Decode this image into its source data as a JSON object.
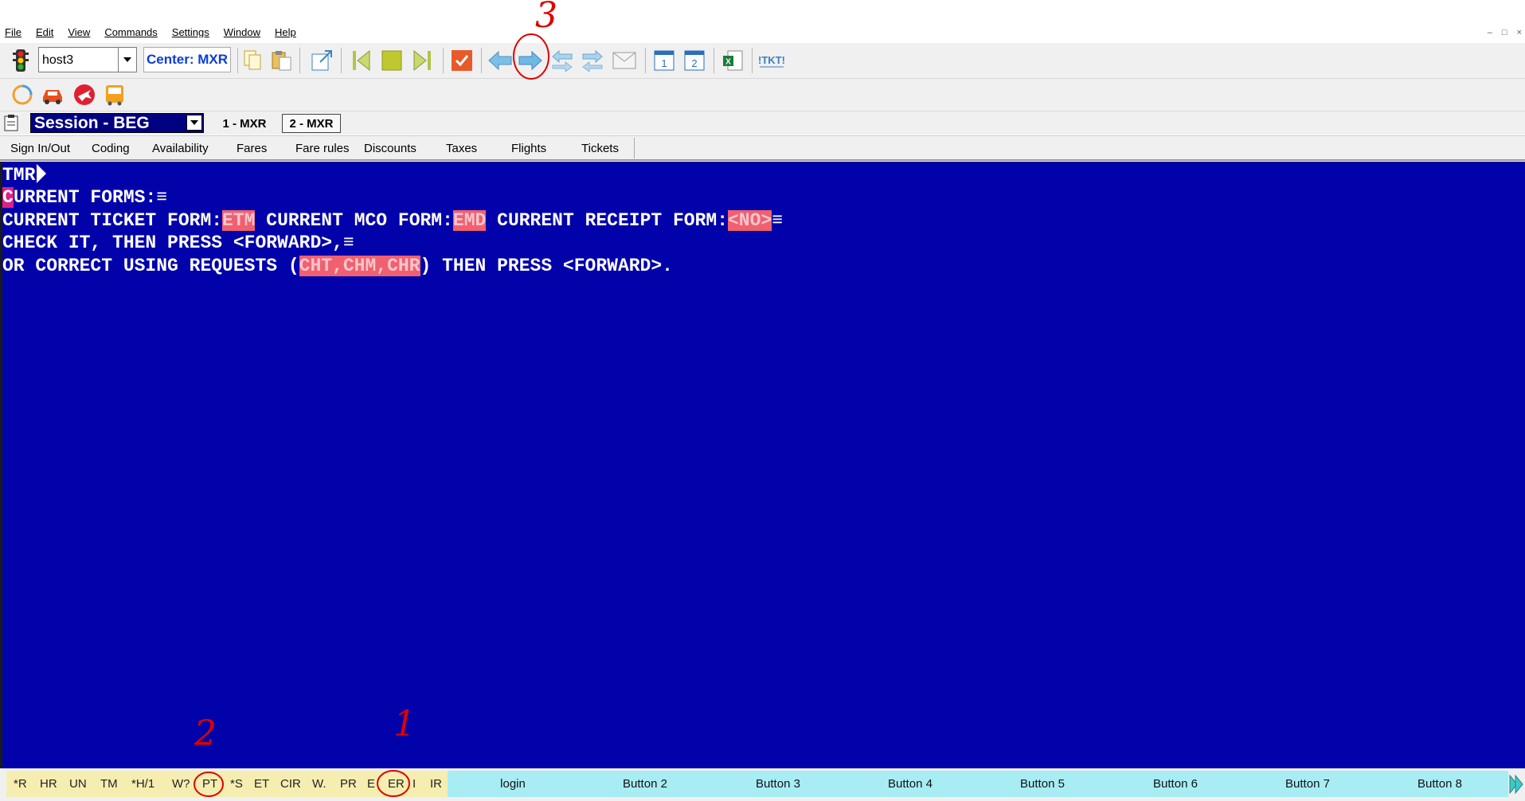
{
  "menu": {
    "items": [
      "File",
      "Edit",
      "View",
      "Commands",
      "Settings",
      "Window",
      "Help"
    ]
  },
  "toolbar": {
    "host": "host3",
    "center": "Center: MXR",
    "tkt_label": "!TKT!"
  },
  "session": {
    "title": "Session - BEG",
    "tabs": [
      "1 - MXR",
      "2 - MXR"
    ]
  },
  "function_tabs": [
    "Sign In/Out",
    "Coding",
    "Availability",
    "Fares",
    "Fare rules",
    "Discounts",
    "Taxes",
    "Flights",
    "Tickets"
  ],
  "terminal": {
    "prompt": "TMR",
    "line1": {
      "cursor": "C",
      "text": "URRENT FORMS:",
      "end": "≡"
    },
    "line2": {
      "a": "CURRENT TICKET FORM:",
      "b": "ETM",
      "c": " CURRENT MCO FORM:",
      "d": "EMD",
      "e": " CURRENT RECEIPT FORM:",
      "f": "<NO>",
      "end": "≡"
    },
    "line3": {
      "text": "CHECK IT, THEN PRESS <FORWARD>,",
      "end": "≡"
    },
    "line4": {
      "a": "OR CORRECT USING REQUESTS (",
      "b": "CHT,CHM,CHR",
      "c": ") THEN PRESS <FORWARD>."
    }
  },
  "quick_buttons": [
    "*R",
    "HR",
    "UN",
    "TM",
    "*H/1",
    "W?",
    "PT",
    "*S",
    "ET",
    "CIR",
    "W.",
    "PR",
    "E",
    "ER",
    "I",
    "IR"
  ],
  "buttons": [
    "login",
    "Button 2",
    "Button 3",
    "Button 4",
    "Button 5",
    "Button 6",
    "Button 7",
    "Button 8"
  ],
  "annotations": {
    "one": "1",
    "two": "2",
    "three": "3"
  },
  "colors": {
    "terminal_bg": "#0202aa",
    "highlight": "#f06070",
    "annotation": "#e00000",
    "session_title_bg": "#000080"
  }
}
